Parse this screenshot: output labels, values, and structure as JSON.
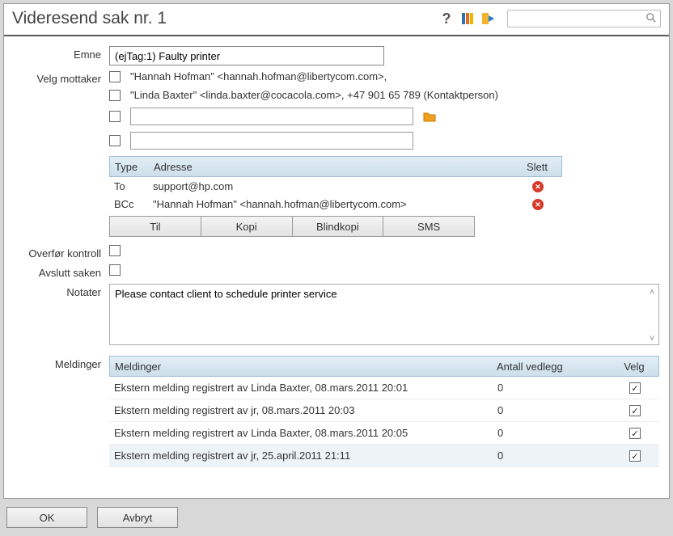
{
  "header": {
    "title": "Videresend sak nr. 1"
  },
  "labels": {
    "emne": "Emne",
    "velg_mottaker": "Velg mottaker",
    "overfor_kontroll": "Overfør kontroll",
    "avslutt_saken": "Avslutt saken",
    "notater": "Notater",
    "meldinger": "Meldinger"
  },
  "fields": {
    "emne_value": "(ejTag:1) Faulty printer",
    "notater_value": "Please contact client to schedule printer service"
  },
  "recipients": {
    "line1": "\"Hannah Hofman\" <hannah.hofman@libertycom.com>,",
    "line2": "\"Linda Baxter\" <linda.baxter@cocacola.com>, +47 901 65 789 (Kontaktperson)"
  },
  "address_headers": {
    "type": "Type",
    "adresse": "Adresse",
    "slett": "Slett"
  },
  "addresses": [
    {
      "type": "To",
      "addr": "support@hp.com"
    },
    {
      "type": "BCc",
      "addr": "\"Hannah Hofman\" <hannah.hofman@libertycom.com>"
    }
  ],
  "buttons": {
    "til": "Til",
    "kopi": "Kopi",
    "blindkopi": "Blindkopi",
    "sms": "SMS",
    "ok": "OK",
    "avbryt": "Avbryt"
  },
  "messages_headers": {
    "meldinger": "Meldinger",
    "antall_vedlegg": "Antall vedlegg",
    "velg": "Velg"
  },
  "messages": [
    {
      "text": "Ekstern melding registrert av Linda Baxter, 08.mars.2011 20:01",
      "att": "0",
      "checked": true
    },
    {
      "text": "Ekstern melding registrert av jr, 08.mars.2011 20:03",
      "att": "0",
      "checked": true
    },
    {
      "text": "Ekstern melding registrert av Linda Baxter, 08.mars.2011 20:05",
      "att": "0",
      "checked": true
    },
    {
      "text": "Ekstern melding registrert av jr, 25.april.2011 21:11",
      "att": "0",
      "checked": true
    }
  ]
}
